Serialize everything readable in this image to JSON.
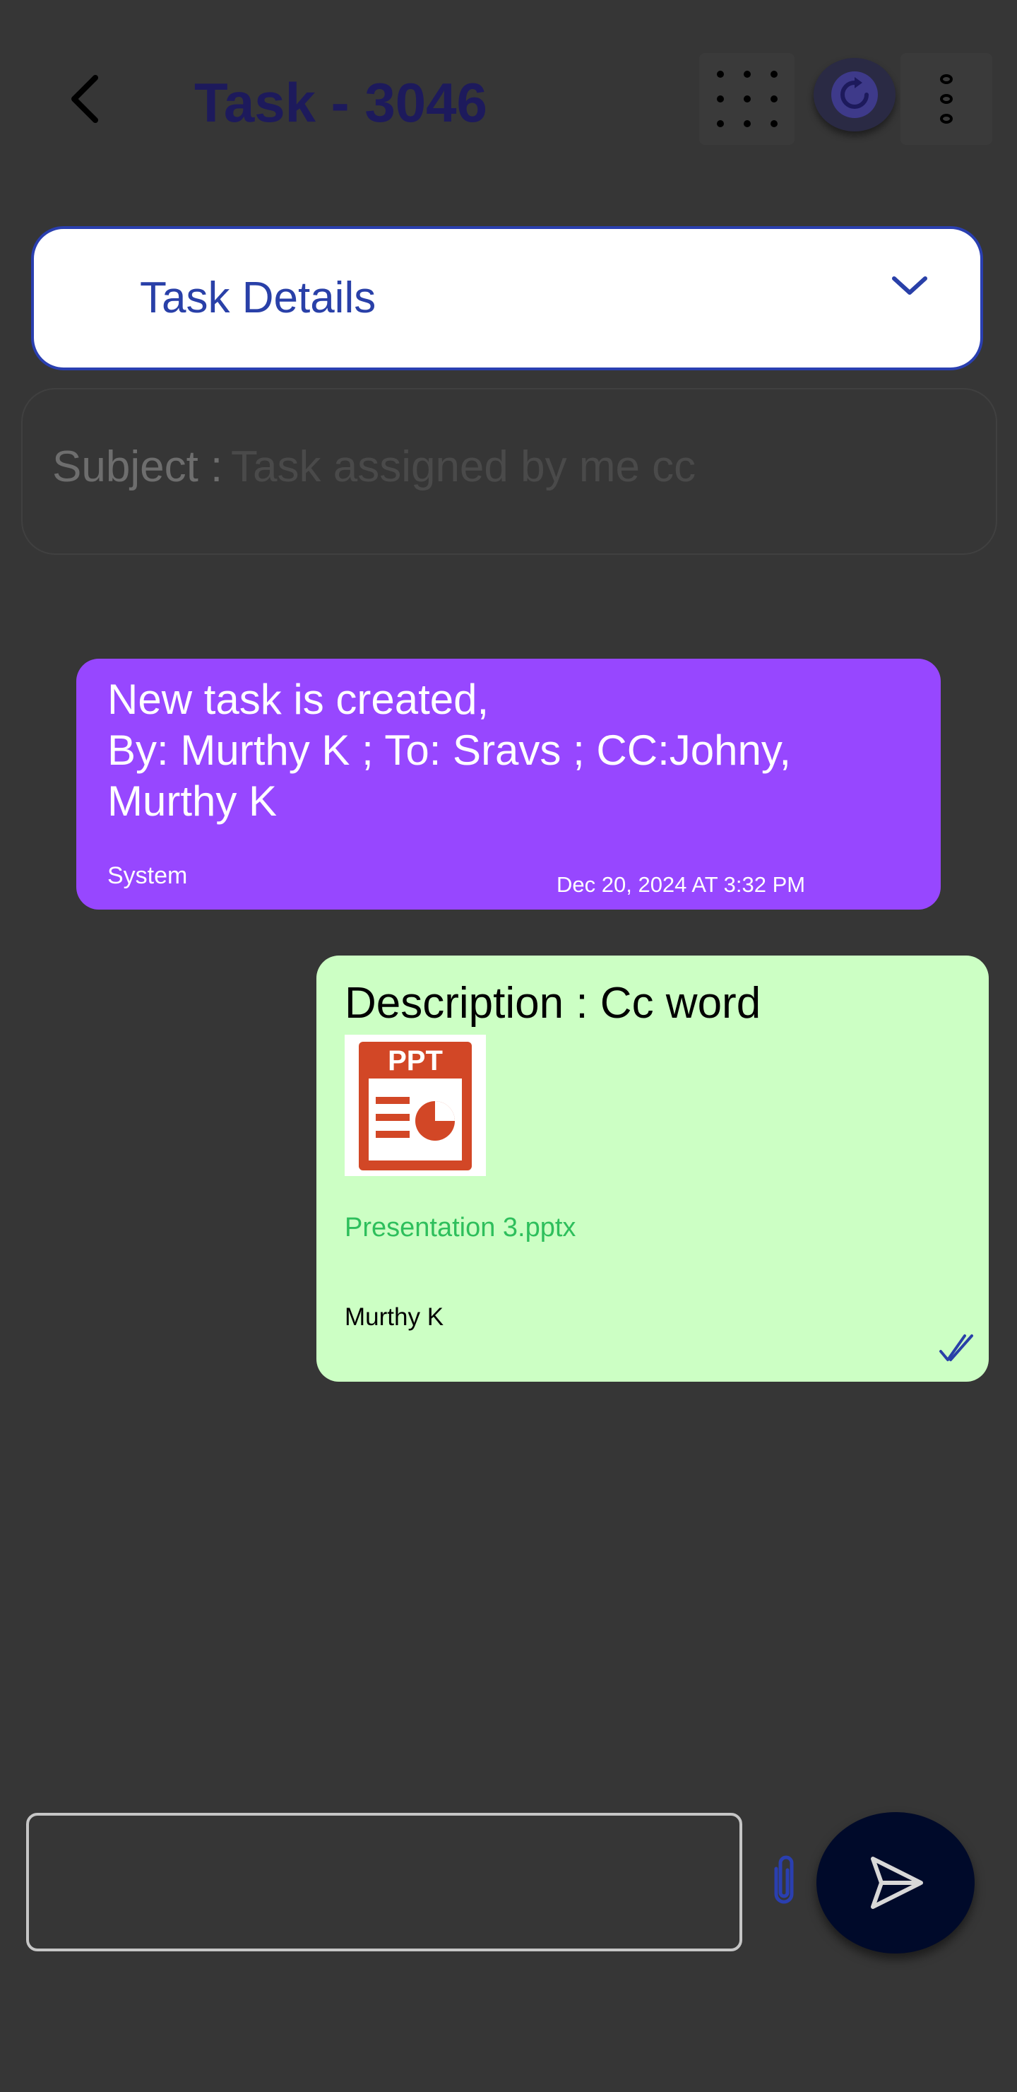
{
  "header": {
    "title": "Task - 3046",
    "back_icon": "chevron-left-icon",
    "grid_icon": "dots-grid-icon",
    "refresh_icon": "refresh-icon",
    "more_icon": "more-vertical-icon"
  },
  "task_details": {
    "label": "Task Details",
    "icon": "chevron-down-icon"
  },
  "subject": {
    "label": "Subject :",
    "value": "Task assigned by me cc"
  },
  "messages": {
    "system": {
      "lines": [
        "New task is created,",
        "By: Murthy K ; To: Sravs ; CC:Johny,",
        "Murthy K"
      ],
      "sender": "System",
      "timestamp": "Dec 20, 2024 AT 3:32 PM",
      "bg_color": "#9747ff"
    },
    "user": {
      "description": "Description : Cc word",
      "attachment": {
        "icon": "ppt-file-icon",
        "icon_label": "PPT",
        "file_name": "Presentation 3.pptx"
      },
      "sender": "Murthy K",
      "status_icon": "double-check-icon",
      "bg_color": "#ccffc4"
    }
  },
  "composer": {
    "placeholder": "",
    "attach_icon": "paperclip-icon",
    "send_icon": "send-icon"
  },
  "colors": {
    "background": "#363636",
    "accent": "#2a3fb0",
    "title": "#1d1a5c",
    "file_link": "#2ebf5c"
  }
}
